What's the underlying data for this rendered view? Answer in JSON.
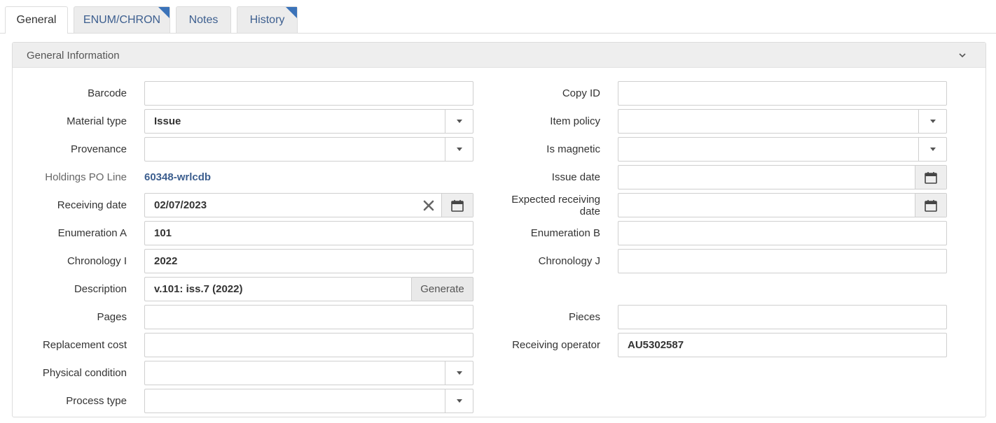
{
  "tabs": [
    {
      "label": "General",
      "active": true
    },
    {
      "label": "ENUM/CHRON",
      "active": false
    },
    {
      "label": "Notes",
      "active": false
    },
    {
      "label": "History",
      "active": false
    }
  ],
  "panel": {
    "title": "General Information"
  },
  "left": {
    "barcode": {
      "label": "Barcode",
      "value": ""
    },
    "material_type": {
      "label": "Material type",
      "value": "Issue"
    },
    "provenance": {
      "label": "Provenance",
      "value": ""
    },
    "holdings_po_line": {
      "label": "Holdings PO Line",
      "value": "60348-wrlcdb"
    },
    "receiving_date": {
      "label": "Receiving date",
      "value": "02/07/2023"
    },
    "enumeration_a": {
      "label": "Enumeration A",
      "value": "101"
    },
    "chronology_i": {
      "label": "Chronology I",
      "value": "2022"
    },
    "description": {
      "label": "Description",
      "value": "v.101: iss.7 (2022)",
      "button": "Generate"
    },
    "pages": {
      "label": "Pages",
      "value": ""
    },
    "replacement_cost": {
      "label": "Replacement cost",
      "value": ""
    },
    "physical_condition": {
      "label": "Physical condition",
      "value": ""
    },
    "process_type": {
      "label": "Process type",
      "value": ""
    }
  },
  "right": {
    "copy_id": {
      "label": "Copy ID",
      "value": ""
    },
    "item_policy": {
      "label": "Item policy",
      "value": ""
    },
    "is_magnetic": {
      "label": "Is magnetic",
      "value": ""
    },
    "issue_date": {
      "label": "Issue date",
      "value": ""
    },
    "expected_receiving_date": {
      "label_line1": "Expected receiving",
      "label_line2": "date",
      "value": ""
    },
    "enumeration_b": {
      "label": "Enumeration B",
      "value": ""
    },
    "chronology_j": {
      "label": "Chronology J",
      "value": ""
    },
    "pieces": {
      "label": "Pieces",
      "value": ""
    },
    "receiving_operator": {
      "label": "Receiving operator",
      "value": "AU5302587"
    }
  },
  "icons": {
    "tab_corner": "note-corner-icon",
    "collapse": "chevron-down-icon",
    "dropdown": "caret-down-icon",
    "calendar": "calendar-icon",
    "clear": "clear-x-icon"
  },
  "colors": {
    "link": "#3d5f8f",
    "tab_corner": "#3b73b9",
    "panel_header": "#eeeeee"
  }
}
